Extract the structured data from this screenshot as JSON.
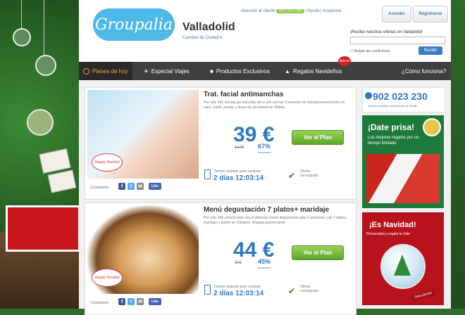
{
  "header": {
    "logo_text": "Groupalia",
    "city": "Valladolid",
    "city_change": "Cambiar de Ciudad ▾",
    "top_links": {
      "attention": "Atención al cliente",
      "phone": "902 023 230",
      "help": "Ayuda",
      "academy": "Academia"
    },
    "access_button": "Acceder",
    "register_button": "Registrarse",
    "signup_title": "¡Recibe nuestras ofertas en Valladolid!",
    "email_placeholder": "",
    "accept_text": "Acepto las condiciones",
    "receive_button": "Recibir"
  },
  "nav": {
    "items": [
      {
        "label": "Planes de hoy",
        "active": true
      },
      {
        "label": "Especial Viajes",
        "active": false
      },
      {
        "label": "Productos Exclusivos",
        "active": false
      },
      {
        "label": "Regalos Navideños",
        "active": false
      },
      {
        "label": "¿Cómo funciona?",
        "active": false
      }
    ],
    "new_badge": "Nuevo"
  },
  "deals": [
    {
      "title": "Trat. facial antimanchas",
      "description": "Por sólo 39€ elimina las manchas de tu piel con las 3 sesiones de fotorejuvenecimiento en cara, cuello, escote y dorso de las manos en Milada",
      "price": "39 €",
      "old_price": "120€",
      "discount": "67%",
      "discount_label": "descuento",
      "button": "Ver el Plan",
      "timer_label": "Tiempo restante para comprar",
      "timer_value": "2 días 12:03:14",
      "status": "Oferta conseguida",
      "share_label": "Compártelo:",
      "gift_label": "Regalo Navidad"
    },
    {
      "title": "Menú degustación 7 platos+ maridaje",
      "description": "Por sólo 44€ cómelo todo con el delicioso menú degustación para 2 personas; con 7 platos, maridaje y postre en Cáñamo. ¡Regala gastronomía!",
      "price": "44 €",
      "old_price": "80€",
      "discount": "45%",
      "discount_label": "descuento",
      "button": "Ver el Plan",
      "timer_label": "Tiempo restante para comprar",
      "timer_value": "2 días 12:03:14",
      "status": "Oferta conseguida",
      "share_label": "Compártelo:",
      "gift_label": "Regalo Navidad"
    }
  ],
  "sidebar": {
    "phone": "902 023 230",
    "phone_note": "Nuestro teléfono de Atención al Cliente",
    "promo1_title": "¡Date prisa!",
    "promo1_sub": "Los mejores regalos por un tiempo limitado",
    "promo2_title": "¡Es Navidad!",
    "promo2_sub": "Personaliza y regala tu Vale",
    "promo2_cta": "Descúbrelo"
  },
  "colors": {
    "brand_blue": "#4cb9e6",
    "price_blue": "#2f79c2",
    "cta_green": "#5aa628",
    "nav_bg": "#3f3f3f",
    "active_orange": "#f5a623"
  }
}
